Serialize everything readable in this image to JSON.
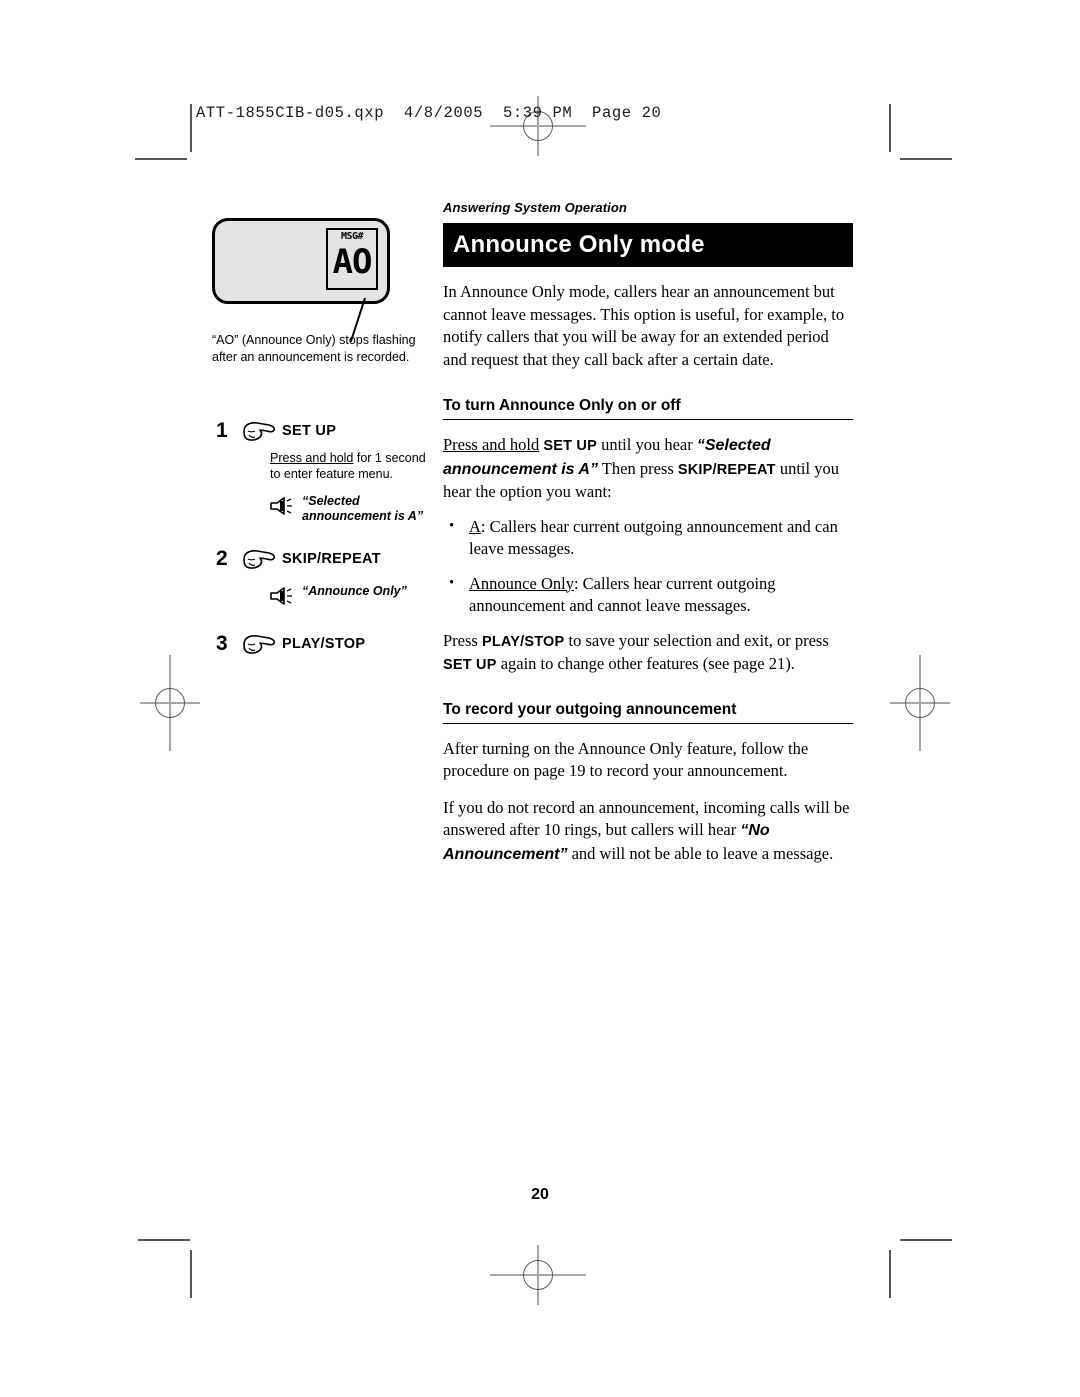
{
  "print_header": "ATT-1855CIB-d05.qxp  4/8/2005  5:39 PM  Page 20",
  "eyebrow": "Answering System Operation",
  "page_title": "Announce Only mode",
  "intro_paragraph": "In Announce Only mode, callers hear an announcement but cannot leave messages. This option is useful, for example, to notify callers that you will be away for an extended period and request that they call back after a certain date.",
  "illustration": {
    "lcd_label": "MSG#",
    "lcd_value": "AO",
    "caption": "“AO” (Announce Only) stops flashing after an announcement is recorded."
  },
  "steps": [
    {
      "number": "1",
      "button": "SET UP",
      "note_underline": "Press and hold",
      "note_rest": " for 1 second to enter feature menu.",
      "voice_prompt": "“Selected announcement is A”"
    },
    {
      "number": "2",
      "button": "SKIP/REPEAT",
      "voice_prompt": "“Announce Only”"
    },
    {
      "number": "3",
      "button": "PLAY/STOP"
    }
  ],
  "section_on_off": {
    "heading": "To turn Announce Only on or off",
    "intro": {
      "underlined": "Press and hold",
      "button1": "SET UP",
      "mid1": " until you hear ",
      "quote": "“Selected announcement is A”",
      "mid2": " Then press ",
      "button2": "SKIP/REPEAT",
      "tail": " until you hear the option you want:"
    },
    "bullets": [
      {
        "term": "A",
        "text": ": Callers hear current outgoing announcement and can leave messages."
      },
      {
        "term": "Announce Only",
        "text": ": Callers hear current outgoing announcement and cannot leave messages."
      }
    ],
    "closing": {
      "pre": "Press ",
      "button1": "PLAY/STOP",
      "mid": " to save your selection and exit, or press ",
      "button2": "SET UP",
      "tail": " again to change other features (see page 21)."
    }
  },
  "section_record": {
    "heading": "To record your outgoing announcement",
    "paragraph1": "After turning on the Announce Only feature, follow the procedure on page 19 to record your announcement.",
    "paragraph2": {
      "pre": "If you do not record an announcement, incoming calls will be answered after 10 rings, but callers will hear ",
      "quote": "“No Announcement”",
      "tail": " and will not be able to leave a message."
    }
  },
  "folio": "20",
  "colors": {
    "title_bar_bg": "#000000",
    "title_bar_text": "#ffffff",
    "lcd_fill": "#e3e3e3",
    "crop_mark": "#58585a"
  }
}
